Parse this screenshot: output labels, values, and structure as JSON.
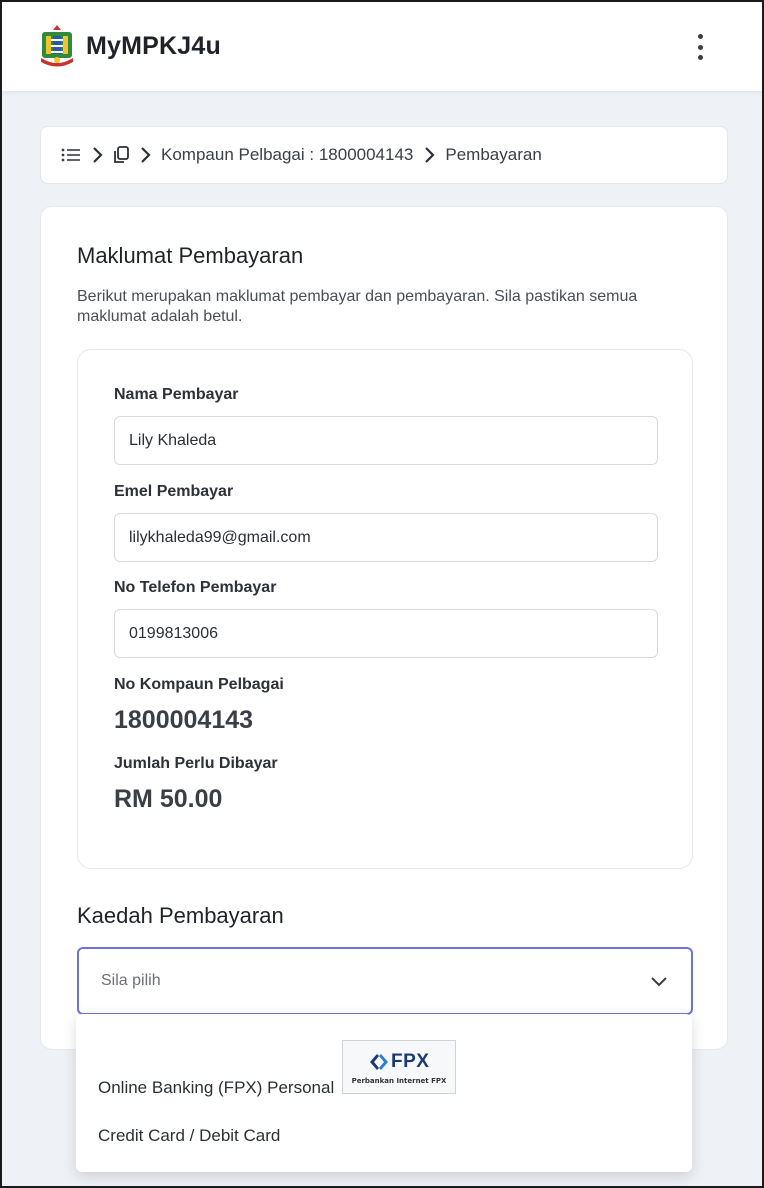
{
  "header": {
    "app_title": "MyMPKJ4u",
    "logo_icon": "mpkj-crest-icon",
    "menu_icon": "more-vertical-icon"
  },
  "breadcrumb": {
    "menu_icon": "list-icon",
    "sep_icon": "chevron-right-icon",
    "doc_icon": "copy-document-icon",
    "items": [
      "Kompaun Pelbagai : 1800004143",
      "Pembayaran"
    ]
  },
  "payment_info": {
    "title": "Maklumat Pembayaran",
    "description": "Berikut merupakan maklumat pembayar dan pembayaran. Sila pastikan semua maklumat adalah betul.",
    "payer_name_label": "Nama Pembayar",
    "payer_name_value": "Lily Khaleda",
    "payer_email_label": "Emel Pembayar",
    "payer_email_value": "lilykhaleda99@gmail.com",
    "payer_phone_label": "No Telefon Pembayar",
    "payer_phone_value": "0199813006",
    "compound_no_label": "No Kompaun Pelbagai",
    "compound_no_value": "1800004143",
    "amount_label": "Jumlah Perlu Dibayar",
    "amount_value": "RM 50.00"
  },
  "payment_method": {
    "title": "Kaedah Pembayaran",
    "select_placeholder": "Sila pilih",
    "options": [
      {
        "label": "Online Banking (FPX) Personal",
        "logo_text": "FPX",
        "logo_subtext": "Perbankan Internet FPX"
      },
      {
        "label": "Credit Card / Debit Card"
      }
    ]
  },
  "colors": {
    "accent_border": "#6c74d8",
    "background": "#eef1f5",
    "fpx_blue": "#1c3a72"
  }
}
